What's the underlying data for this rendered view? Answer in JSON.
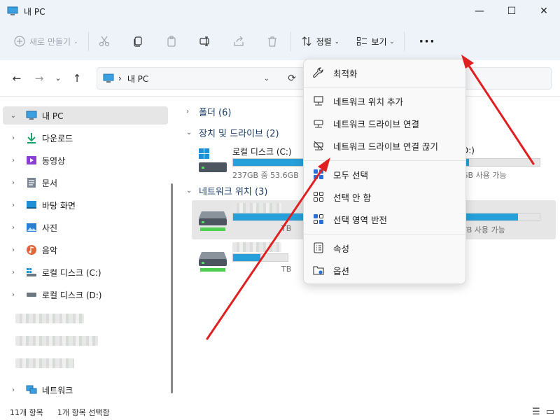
{
  "window": {
    "title": "내 PC",
    "minimize_glyph": "—",
    "maximize_glyph": "☐",
    "close_glyph": "✕"
  },
  "toolbar": {
    "new_label": "새로 만들기",
    "sort_label": "정렬",
    "view_label": "보기",
    "more_label": "···",
    "chevron": "⌄",
    "icons": [
      "new-icon",
      "cut-icon",
      "copy-icon",
      "paste-icon",
      "rename-icon",
      "share-icon",
      "delete-icon",
      "sort-icon",
      "view-icon",
      "more-icon"
    ]
  },
  "address": {
    "back": "←",
    "forward": "→",
    "recent": "⌄",
    "up": "↑",
    "separator": "›",
    "path": "내 PC",
    "dropdown": "⌄",
    "refresh": "⟳"
  },
  "sidebar": {
    "items": [
      {
        "label": "내 PC",
        "arrow": "⌄",
        "icon": "pc-icon",
        "selected": true
      },
      {
        "label": "다운로드",
        "arrow": "›",
        "icon": "download-icon"
      },
      {
        "label": "동영상",
        "arrow": "›",
        "icon": "video-icon"
      },
      {
        "label": "문서",
        "arrow": "›",
        "icon": "document-icon"
      },
      {
        "label": "바탕 화면",
        "arrow": "›",
        "icon": "desktop-icon"
      },
      {
        "label": "사진",
        "arrow": "›",
        "icon": "picture-icon"
      },
      {
        "label": "음악",
        "arrow": "›",
        "icon": "music-icon"
      },
      {
        "label": "로컬 디스크 (C:)",
        "arrow": "›",
        "icon": "drive-c-icon"
      },
      {
        "label": "로컬 디스크 (D:)",
        "arrow": "›",
        "icon": "drive-d-icon"
      },
      {
        "label": "네트워크",
        "arrow": "›",
        "icon": "network-icon"
      }
    ]
  },
  "content": {
    "groups": [
      {
        "chevron": "›",
        "label": "폴더 (6)"
      },
      {
        "chevron": "⌄",
        "label": "장치 및 드라이브 (2)"
      },
      {
        "chevron": "⌄",
        "label": "네트워크 위치 (3)"
      }
    ],
    "drives": [
      {
        "name": "로컬 디스크 (C:)",
        "size_text": "237GB 중 53.6GB",
        "right_text": "GB 사용 가능",
        "used_fraction": 0.77
      },
      {
        "name": "",
        "size_text": "",
        "right_text": "TB 사용 가능",
        "mid_text": "TB",
        "used_fraction": 0.93
      },
      {
        "name": "",
        "size_text": "",
        "right_text": "",
        "mid_text": "TB",
        "used_fraction": 0.5
      }
    ],
    "right_c_label": "D:)"
  },
  "menu": {
    "items": [
      {
        "label": "최적화",
        "icon": "wrench-icon"
      },
      {
        "label": "네트워크 위치 추가",
        "icon": "network-location-icon"
      },
      {
        "label": "네트워크 드라이브 연결",
        "icon": "map-drive-icon"
      },
      {
        "label": "네트워크 드라이브 연결 끊기",
        "icon": "disconnect-drive-icon"
      },
      {
        "label": "모두 선택",
        "icon": "select-all-icon"
      },
      {
        "label": "선택 안 함",
        "icon": "select-none-icon"
      },
      {
        "label": "선택 영역 반전",
        "icon": "invert-selection-icon"
      },
      {
        "label": "속성",
        "icon": "properties-icon"
      },
      {
        "label": "옵션",
        "icon": "options-icon"
      }
    ]
  },
  "status": {
    "count": "11개 항목",
    "selected": "1개 항목 선택함",
    "details_view": "☰",
    "tiles_view": "▭"
  },
  "colors": {
    "accent": "#26a0da",
    "annotation": "#e02020",
    "chrome": "#eef3fa",
    "header": "#1a3f6b"
  }
}
